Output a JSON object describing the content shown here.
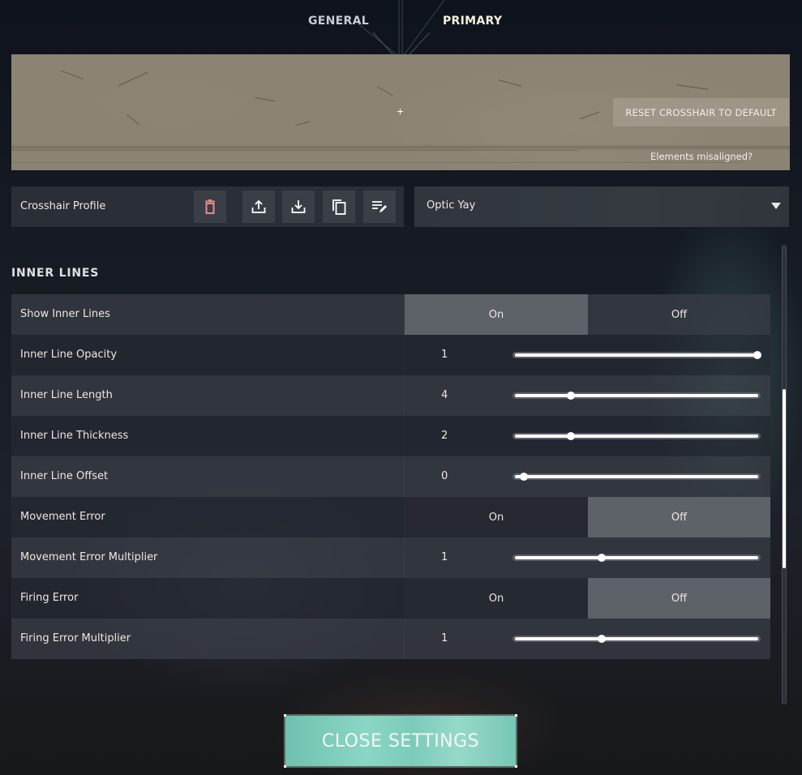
{
  "tabs": [
    {
      "label": "GENERAL",
      "active": false
    },
    {
      "label": "PRIMARY",
      "active": true
    }
  ],
  "preview": {
    "reset_label": "RESET CROSSHAIR TO DEFAULT",
    "misaligned_label": "Elements misaligned?"
  },
  "profile": {
    "label": "Crosshair Profile",
    "selected": "Optic Yay",
    "actions": [
      {
        "name": "delete",
        "icon": "trash-icon",
        "color": "#e88a8a"
      },
      {
        "name": "export",
        "icon": "upload-icon",
        "color": "#ffffff"
      },
      {
        "name": "import",
        "icon": "download-icon",
        "color": "#ffffff"
      },
      {
        "name": "copy",
        "icon": "copy-icon",
        "color": "#ffffff"
      },
      {
        "name": "rename",
        "icon": "edit-list-icon",
        "color": "#ffffff"
      }
    ]
  },
  "section": {
    "title": "INNER LINES",
    "rows": [
      {
        "label": "Show Inner Lines",
        "type": "toggle",
        "on_label": "On",
        "off_label": "Off",
        "value": "On"
      },
      {
        "label": "Inner Line Opacity",
        "type": "slider",
        "value": "1",
        "fraction": 1.0
      },
      {
        "label": "Inner Line Length",
        "type": "slider",
        "value": "4",
        "fraction": 0.2
      },
      {
        "label": "Inner Line Thickness",
        "type": "slider",
        "value": "2",
        "fraction": 0.2
      },
      {
        "label": "Inner Line Offset",
        "type": "slider",
        "value": "0",
        "fraction": 0.0
      },
      {
        "label": "Movement Error",
        "type": "toggle",
        "on_label": "On",
        "off_label": "Off",
        "value": "Off"
      },
      {
        "label": "Movement Error Multiplier",
        "type": "slider",
        "value": "1",
        "fraction": 0.333
      },
      {
        "label": "Firing Error",
        "type": "toggle",
        "on_label": "On",
        "off_label": "Off",
        "value": "Off"
      },
      {
        "label": "Firing Error Multiplier",
        "type": "slider",
        "value": "1",
        "fraction": 0.333
      }
    ]
  },
  "scrollbar": {
    "position_fraction": 0.5
  },
  "close_label": "CLOSE SETTINGS",
  "colors": {
    "accent": "#7ccbb9",
    "toggle_active": "#5d6168"
  }
}
